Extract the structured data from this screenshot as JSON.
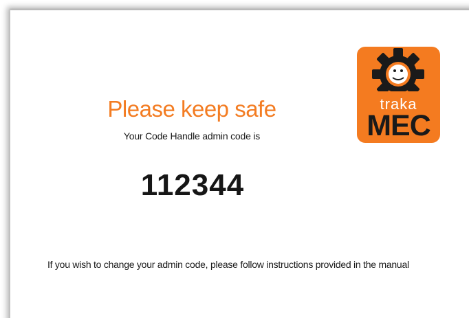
{
  "document": {
    "title": "Please keep safe",
    "subtitle": "Your Code Handle admin code is",
    "admin_code": "112344",
    "instructions": "If you wish to change your admin code, please follow instructions provided in the manual"
  },
  "logo": {
    "top_text": "traka",
    "bottom_text": "MEC",
    "icon": "gear-icon"
  },
  "colors": {
    "accent": "#f37c22",
    "logo_background": "#f47b20",
    "text": "#1a1a1a"
  }
}
